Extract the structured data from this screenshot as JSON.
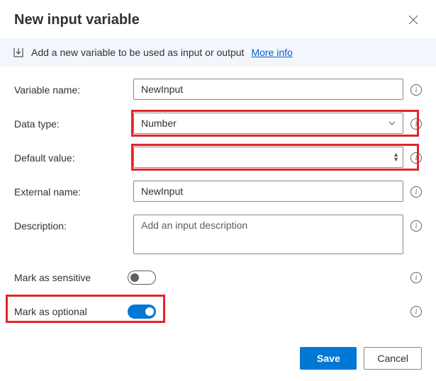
{
  "dialog": {
    "title": "New input variable",
    "banner_text": "Add a new variable to be used as input or output",
    "more_info": "More info"
  },
  "form": {
    "labels": {
      "variable_name": "Variable name:",
      "data_type": "Data type:",
      "default_value": "Default value:",
      "external_name": "External name:",
      "description": "Description:",
      "mark_sensitive": "Mark as sensitive",
      "mark_optional": "Mark as optional"
    },
    "values": {
      "variable_name": "NewInput",
      "data_type": "Number",
      "default_value": "",
      "external_name": "NewInput",
      "description": "",
      "mark_sensitive": false,
      "mark_optional": true
    },
    "placeholders": {
      "description": "Add an input description"
    }
  },
  "footer": {
    "save": "Save",
    "cancel": "Cancel"
  }
}
